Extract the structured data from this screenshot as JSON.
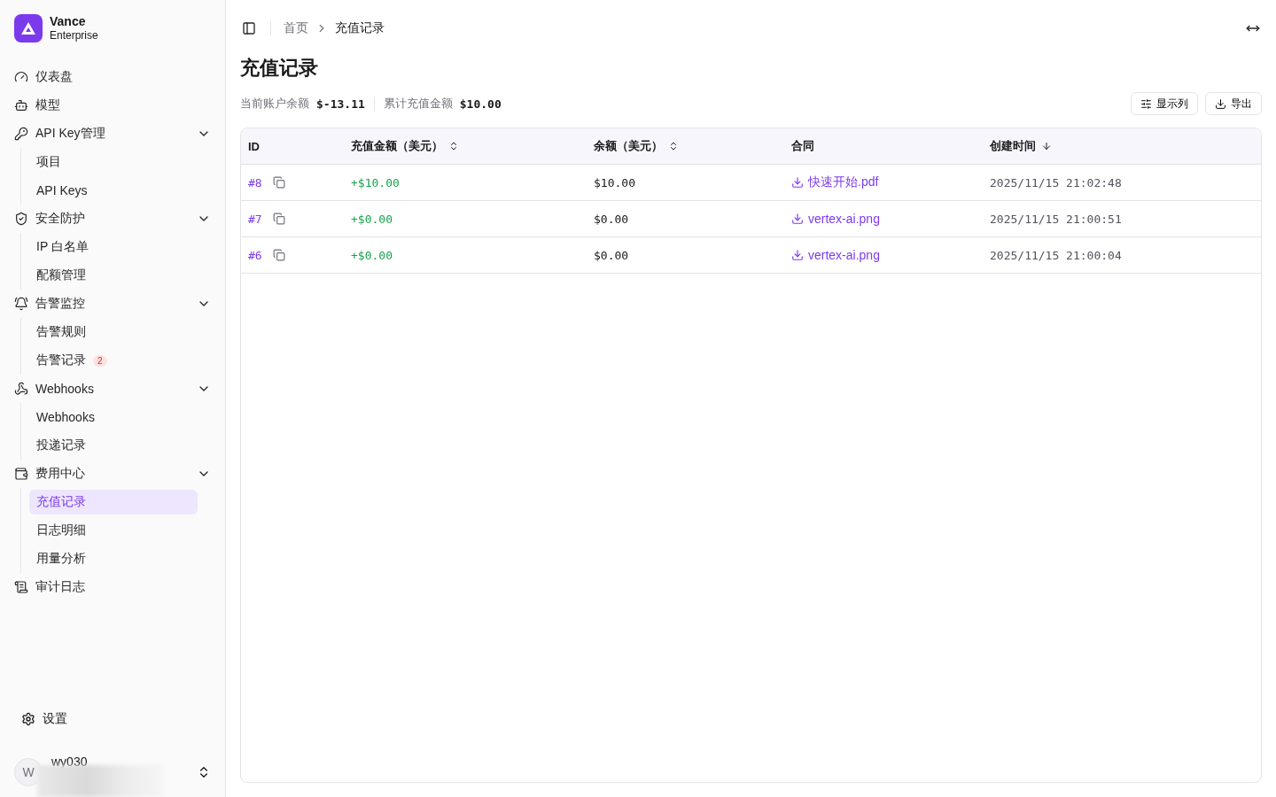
{
  "brand": {
    "name": "Vance",
    "plan": "Enterprise"
  },
  "nav": [
    {
      "label": "仪表盘"
    },
    {
      "label": "模型"
    },
    {
      "label": "API Key管理",
      "expanded": true,
      "children": [
        {
          "label": "项目",
          "selected": false
        },
        {
          "label": "API Keys",
          "selected": false
        }
      ]
    },
    {
      "label": "安全防护",
      "expanded": true,
      "children": [
        {
          "label": "IP 白名单",
          "selected": false
        },
        {
          "label": "配额管理",
          "selected": false
        }
      ]
    },
    {
      "label": "告警监控",
      "expanded": true,
      "children": [
        {
          "label": "告警规则",
          "selected": false
        },
        {
          "label": "告警记录",
          "selected": false,
          "badge": "2"
        }
      ]
    },
    {
      "label": "Webhooks",
      "expanded": true,
      "children": [
        {
          "label": "Webhooks",
          "selected": false
        },
        {
          "label": "投递记录",
          "selected": false
        }
      ]
    },
    {
      "label": "费用中心",
      "expanded": true,
      "children": [
        {
          "label": "充值记录",
          "selected": true
        },
        {
          "label": "日志明细",
          "selected": false
        },
        {
          "label": "用量分析",
          "selected": false
        }
      ]
    },
    {
      "label": "审计日志"
    }
  ],
  "settings": "设置",
  "user": {
    "initial": "W",
    "name": "wy030"
  },
  "breadcrumb": [
    {
      "label": "首页",
      "current": false
    },
    {
      "label": "充值记录",
      "current": true
    }
  ],
  "title": "充值记录",
  "summary": [
    {
      "label": "当前账户余额",
      "value": "$-13.11"
    },
    {
      "label": "累计充值金额",
      "value": "$10.00"
    }
  ],
  "actions": [
    {
      "label": "显示列"
    },
    {
      "label": "导出"
    }
  ],
  "table": {
    "columns": [
      {
        "label": "ID",
        "kind": "plain"
      },
      {
        "label": "充值金额（美元）",
        "kind": "sortable"
      },
      {
        "label": "余额（美元）",
        "kind": "sortable"
      },
      {
        "label": "合同",
        "kind": "plain"
      },
      {
        "label": "创建时间",
        "kind": "sorted"
      }
    ],
    "rows": [
      {
        "id": "#8",
        "amount": "+$10.00",
        "balance": "$10.00",
        "contract": "快速开始.pdf",
        "created": "2025/11/15 21:02:48"
      },
      {
        "id": "#7",
        "amount": "+$0.00",
        "balance": "$0.00",
        "contract": "vertex-ai.png",
        "created": "2025/11/15 21:00:51"
      },
      {
        "id": "#6",
        "amount": "+$0.00",
        "balance": "$0.00",
        "contract": "vertex-ai.png",
        "created": "2025/11/15 21:00:04"
      }
    ]
  }
}
